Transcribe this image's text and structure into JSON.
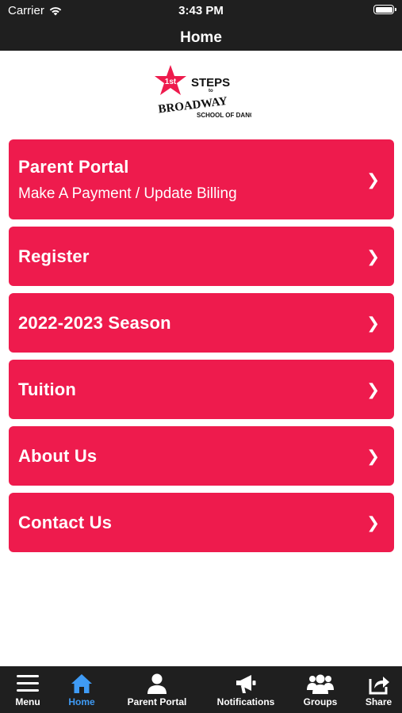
{
  "status_bar": {
    "carrier": "Carrier",
    "time": "3:43 PM"
  },
  "nav": {
    "title": "Home"
  },
  "logo": {
    "line1": "1st",
    "line2": "STEPS",
    "line3": "to",
    "line4": "BROADWAY",
    "line5": "SCHOOL OF DANCE"
  },
  "menu": [
    {
      "label": "Parent Portal",
      "sub": "Make A Payment / Update Billing",
      "chevron": "❯"
    },
    {
      "label": "Register",
      "chevron": "❯"
    },
    {
      "label": "2022-2023 Season",
      "chevron": "❯"
    },
    {
      "label": "Tuition",
      "chevron": "❯"
    },
    {
      "label": "About Us",
      "chevron": "❯"
    },
    {
      "label": "Contact Us",
      "chevron": "❯"
    }
  ],
  "tabs": [
    {
      "label": "Menu",
      "icon": "hamburger-icon"
    },
    {
      "label": "Home",
      "icon": "home-icon",
      "active": true
    },
    {
      "label": "Parent Portal",
      "icon": "user-icon"
    },
    {
      "label": "Notifications",
      "icon": "megaphone-icon"
    },
    {
      "label": "Groups",
      "icon": "group-icon"
    },
    {
      "label": "Share",
      "icon": "share-icon"
    }
  ],
  "colors": {
    "accent": "#ee1b4d",
    "bar": "#1f1f1f",
    "tab_active": "#3f9bf5"
  }
}
